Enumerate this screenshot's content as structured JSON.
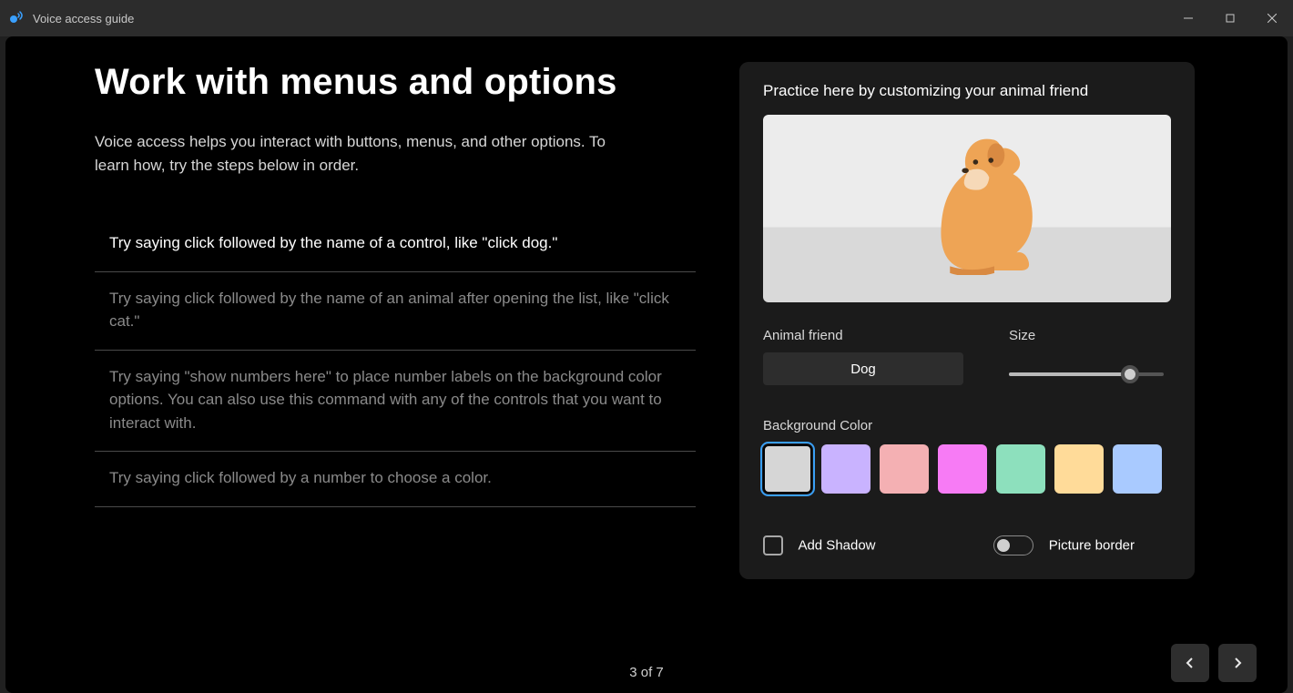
{
  "window": {
    "title": "Voice access guide"
  },
  "main": {
    "heading": "Work with menus and options",
    "intro": "Voice access helps you interact with buttons, menus, and other options. To learn how, try the steps below in order.",
    "steps": [
      "Try saying click followed by the name of a control, like \"click dog.\"",
      "Try saying click followed by the name of an animal after opening the list, like \"click cat.\"",
      "Try saying \"show numbers here\" to place number labels on the background color options. You can also use this command with any of the controls that you want to interact with.",
      "Try saying click followed by a number to choose a color."
    ],
    "active_step_index": 0
  },
  "practice": {
    "heading": "Practice here by customizing your animal friend",
    "animal_label": "Animal friend",
    "animal_value": "Dog",
    "size_label": "Size",
    "size_percent": 78,
    "bg_label": "Background Color",
    "colors": [
      {
        "hex": "#d6d6d6",
        "selected": true
      },
      {
        "hex": "#c9b3ff",
        "selected": false
      },
      {
        "hex": "#f4b0b3",
        "selected": false
      },
      {
        "hex": "#f77bf5",
        "selected": false
      },
      {
        "hex": "#8de0bd",
        "selected": false
      },
      {
        "hex": "#ffdb99",
        "selected": false
      },
      {
        "hex": "#a9caff",
        "selected": false
      }
    ],
    "add_shadow_label": "Add Shadow",
    "add_shadow_checked": false,
    "picture_border_label": "Picture border",
    "picture_border_on": false
  },
  "footer": {
    "page_text": "3 of 7"
  }
}
